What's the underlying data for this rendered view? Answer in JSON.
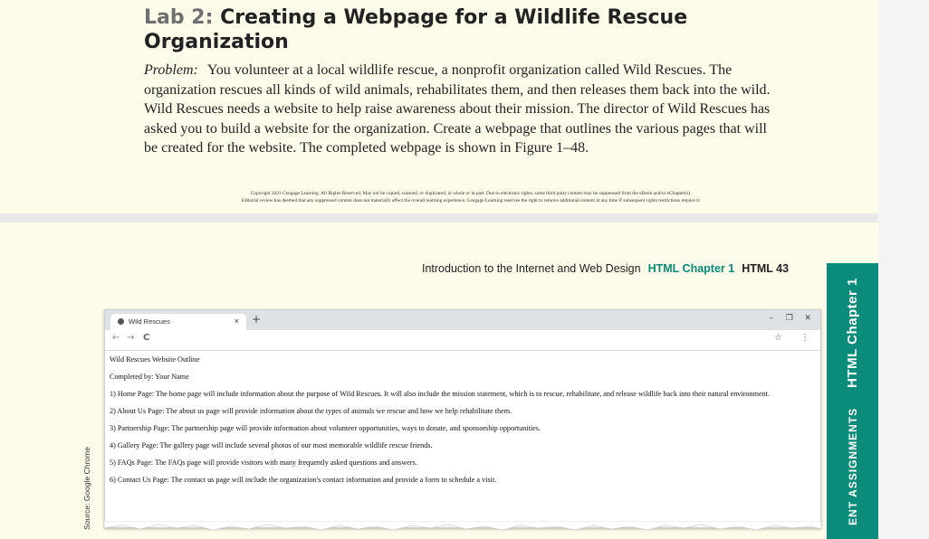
{
  "page1": {
    "lab_number": "Lab 2:",
    "lab_title": "Creating a Webpage for a Wildlife Rescue Organization",
    "problem_label": "Problem:",
    "problem_text": "You volunteer at a local wildlife rescue, a nonprofit organization called Wild Rescues. The organization rescues all kinds of wild animals, rehabilitates them, and then releases them back into the wild. Wild Rescues needs a website to help raise awareness about their mission. The director of Wild Rescues has asked you to build a website for the organization. Create a webpage that outlines the various pages that will be created for the website. The completed webpage is shown in Figure 1–48.",
    "copyright_1": "Copyright 2021 Cengage Learning. All Rights Reserved. May not be copied, scanned, or duplicated, in whole or in part. Due to electronic rights, some third party content may be suppressed from the eBook and/or eChapter(s).",
    "copyright_2": "Editorial review has deemed that any suppressed content does not materially affect the overall learning experience. Cengage Learning reserves the right to remove additional content at any time if subsequent rights restrictions require it."
  },
  "page2": {
    "running_head": "Introduction to the Internet and Web Design",
    "chapter_label": "HTML Chapter 1",
    "page_number": "HTML 43",
    "side_tab_chapter": "HTML Chapter 1",
    "side_tab_section": "ENT ASSIGNMENTS",
    "source_credit": "Source: Google Chrome"
  },
  "browser": {
    "tab_title": "Wild Rescues",
    "tab_close": "×",
    "new_tab": "+",
    "minimize": "–",
    "maximize": "❐",
    "close": "✕",
    "back": "←",
    "forward": "→",
    "reload": "C",
    "star": "☆",
    "menu": "⋮",
    "lines": [
      "Wild Rescues Website Outline",
      "Completed by: Your Name",
      "1) Home Page: The home page will include information about the purpose of Wild Rescues. It will also include the mission statement, which is to rescue, rehabilitate, and release wildlife back into their natural environment.",
      "2) About Us Page: The about us page will provide information about the types of animals we rescue and how we help rehabilitate them.",
      "3) Partnership Page: The partnership page will provide information about volunteer opportunities, ways to donate, and sponsorship opportunities.",
      "4) Gallery Page: The gallery page will include several photos of our most memorable wildlife rescue friends.",
      "5) FAQs Page: The FAQs page will provide visitors with many frequently asked questions and answers.",
      "6) Contact Us Page: The contact us page will include the organization's contact information and provide a form to schedule a visit."
    ]
  },
  "colors": {
    "page_bg": "#fdfbe9",
    "accent_teal": "#0b8c7a",
    "title_text": "#222222",
    "lab_number_gray": "#6f6f6f"
  }
}
